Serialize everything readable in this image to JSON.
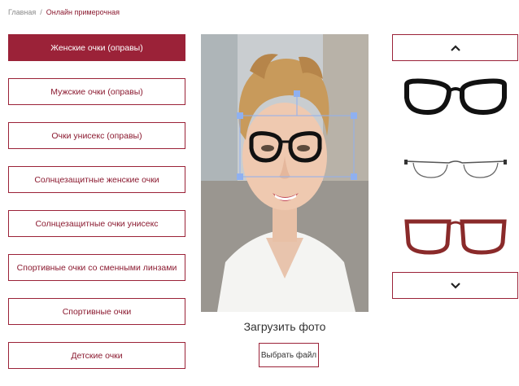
{
  "breadcrumb": {
    "home": "Главная",
    "separator": "/",
    "current": "Онлайн примерочная"
  },
  "categories": [
    {
      "label": "Женские очки (оправы)",
      "active": true
    },
    {
      "label": "Мужские очки (оправы)",
      "active": false
    },
    {
      "label": "Очки унисекс (оправы)",
      "active": false
    },
    {
      "label": "Солнцезащитные женские очки",
      "active": false
    },
    {
      "label": "Солнцезащитные очки унисекс",
      "active": false
    },
    {
      "label": "Спортивные очки со сменными линзами",
      "active": false
    },
    {
      "label": "Спортивные очки",
      "active": false
    },
    {
      "label": "Детские очки",
      "active": false
    }
  ],
  "upload": {
    "title": "Загрузить фото",
    "button_label": "Выбрать файл"
  },
  "frames_carousel": {
    "up_icon": "chevron-up-icon",
    "down_icon": "chevron-down-icon",
    "items": [
      {
        "name": "black-cat-eye-frame",
        "color": "#111111"
      },
      {
        "name": "rimless-thin-frame",
        "color": "#555555"
      },
      {
        "name": "burgundy-square-frame",
        "color": "#8a2a2a"
      }
    ]
  },
  "colors": {
    "accent": "#9b2238",
    "selection_handles": "#8fb0f0"
  }
}
